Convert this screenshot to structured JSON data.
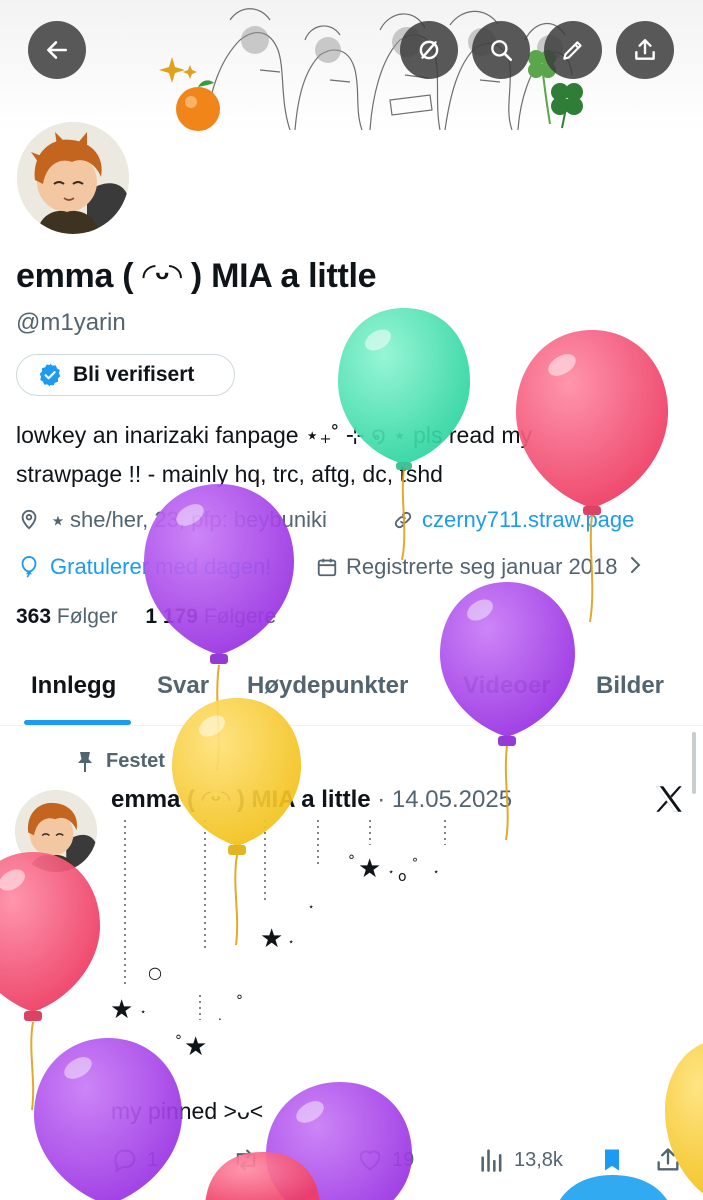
{
  "header": {
    "back_icon": "arrow-left-icon",
    "actions": [
      "circle-slash-icon",
      "search-icon",
      "edit-icon",
      "share-icon"
    ]
  },
  "profile": {
    "display_name": "emma ( ◜ᵕ◝ ) MIA a little",
    "handle": "@m1yarin",
    "verify_button": "Bli verifisert",
    "bio_line1": "lowkey an inarizaki fanpage ⋆₊˚ ⊹ ໑ ⋆ pls read my",
    "bio_line2": "strawpage !! - mainly hq, trc, aftg, dc, tshd",
    "location": "⭑ she/her, 23, pfp: beybuniki",
    "website": "czerny711.straw.page",
    "birthday": "Gratulerer med dagen!",
    "joined": "Registrerte seg januar 2018",
    "following_count": "363",
    "following_label": "Følger",
    "followers_count": "1 179",
    "followers_label": "Følgere"
  },
  "tabs": [
    "Innlegg",
    "Svar",
    "Høydepunkter",
    "Videoer",
    "Bilder"
  ],
  "active_tab": "Innlegg",
  "post": {
    "pinned_label": "Festet",
    "author": "emma ( ◜ᵕ◝ ) MIA a little",
    "date": "· 14.05.2025",
    "text": "my pinned >ᴗ<",
    "replies": "1",
    "reposts": "",
    "likes": "19",
    "views": "13,8k"
  },
  "colors": {
    "accent": "#1d9bf0",
    "text": "#0f1419",
    "muted": "#536471",
    "balloon_green": "#3fe3b0",
    "balloon_red": "#f2476c",
    "balloon_purple": "#a13ee8",
    "balloon_yellow": "#f7cc2a"
  }
}
